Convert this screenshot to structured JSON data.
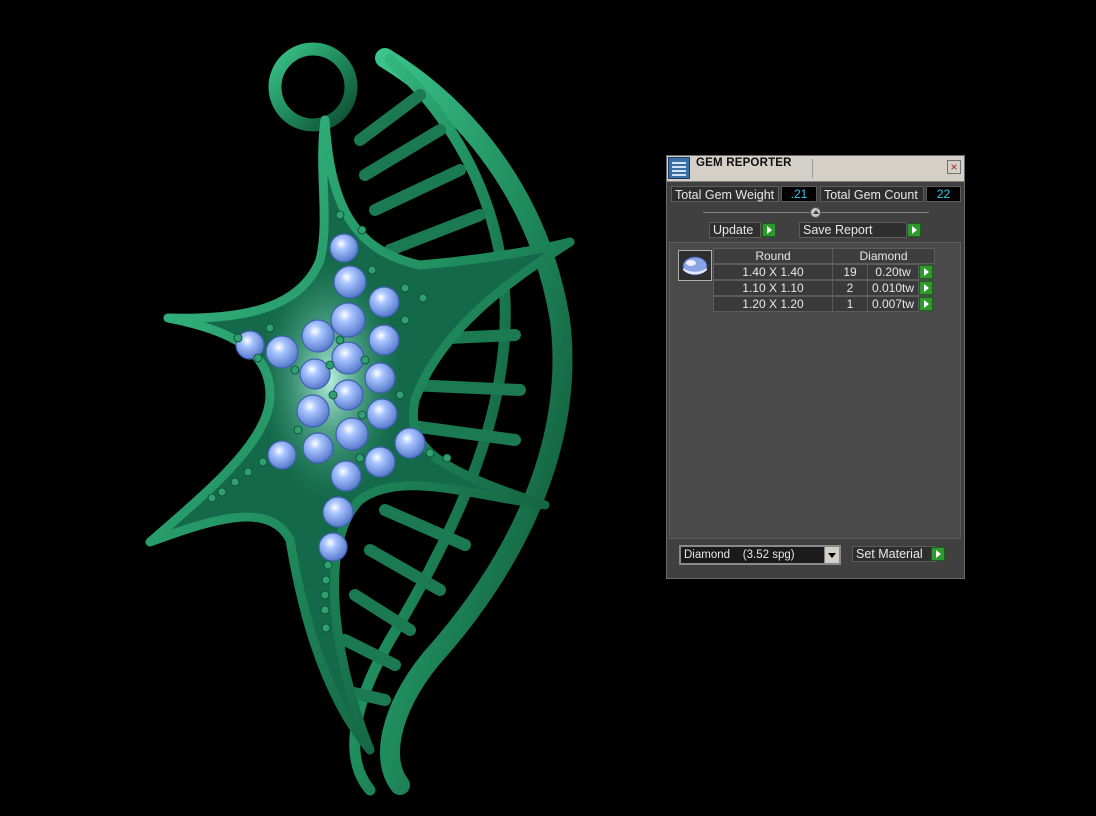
{
  "panel": {
    "title": "GEM REPORTER",
    "close_label": "×",
    "total_weight_label": "Total Gem Weight",
    "total_weight_value": ".21",
    "total_count_label": "Total Gem Count",
    "total_count_value": "22",
    "update_label": "Update",
    "save_report_label": "Save Report",
    "table": {
      "headers": [
        "Round",
        "Diamond"
      ],
      "rows": [
        {
          "size": "1.40 X 1.40",
          "count": "19",
          "weight": "0.20tw"
        },
        {
          "size": "1.10 X 1.10",
          "count": "2",
          "weight": "0.010tw"
        },
        {
          "size": "1.20 X 1.20",
          "count": "1",
          "weight": "0.007tw"
        }
      ]
    },
    "material_select": "Diamond    (3.52 spg)",
    "set_material_label": "Set Material"
  },
  "viewport": {
    "model": "starfish pendant",
    "metal_color": "#1f8a5c",
    "gem_color": "#7fa8f0"
  },
  "icons": [
    "gem-reporter-icon",
    "close-icon",
    "play-arrow-icon",
    "gem-thumbnail-icon",
    "dropdown-arrow-icon"
  ]
}
